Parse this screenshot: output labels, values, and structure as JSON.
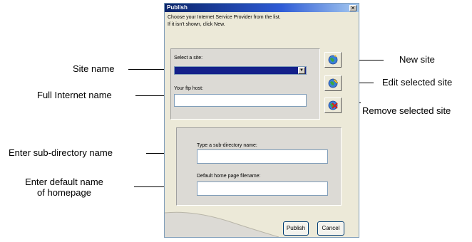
{
  "dialog": {
    "title": "Publish",
    "close_glyph": "✕",
    "intro_line1": "Choose your Internet Service Provider from the list.",
    "intro_line2": "If it isn't shown, click New.",
    "site_label": "Select a site:",
    "site_value": "",
    "ftp_label": "Your ftp host:",
    "ftp_value": "",
    "subdir_label": "Type a sub-directory name:",
    "subdir_value": "",
    "homepage_label": "Default home page filename:",
    "homepage_value": "",
    "publish_label": "Publish",
    "cancel_label": "Cancel"
  },
  "icons": {
    "new": "globe-new-icon",
    "edit": "globe-edit-icon",
    "remove": "globe-remove-icon"
  },
  "callouts": {
    "site_name": "Site name",
    "full_internet_name": "Full Internet name",
    "sub_directory": "Enter sub-directory name",
    "default_name_line1": "Enter default name",
    "default_name_line2": "of homepage",
    "new_site": "New site",
    "edit_site": "Edit selected site",
    "remove_site": "Remove selected site"
  },
  "colors": {
    "titlebar": "#0a246a",
    "selection": "#14208a",
    "dialog_bg": "#ece9d8"
  }
}
